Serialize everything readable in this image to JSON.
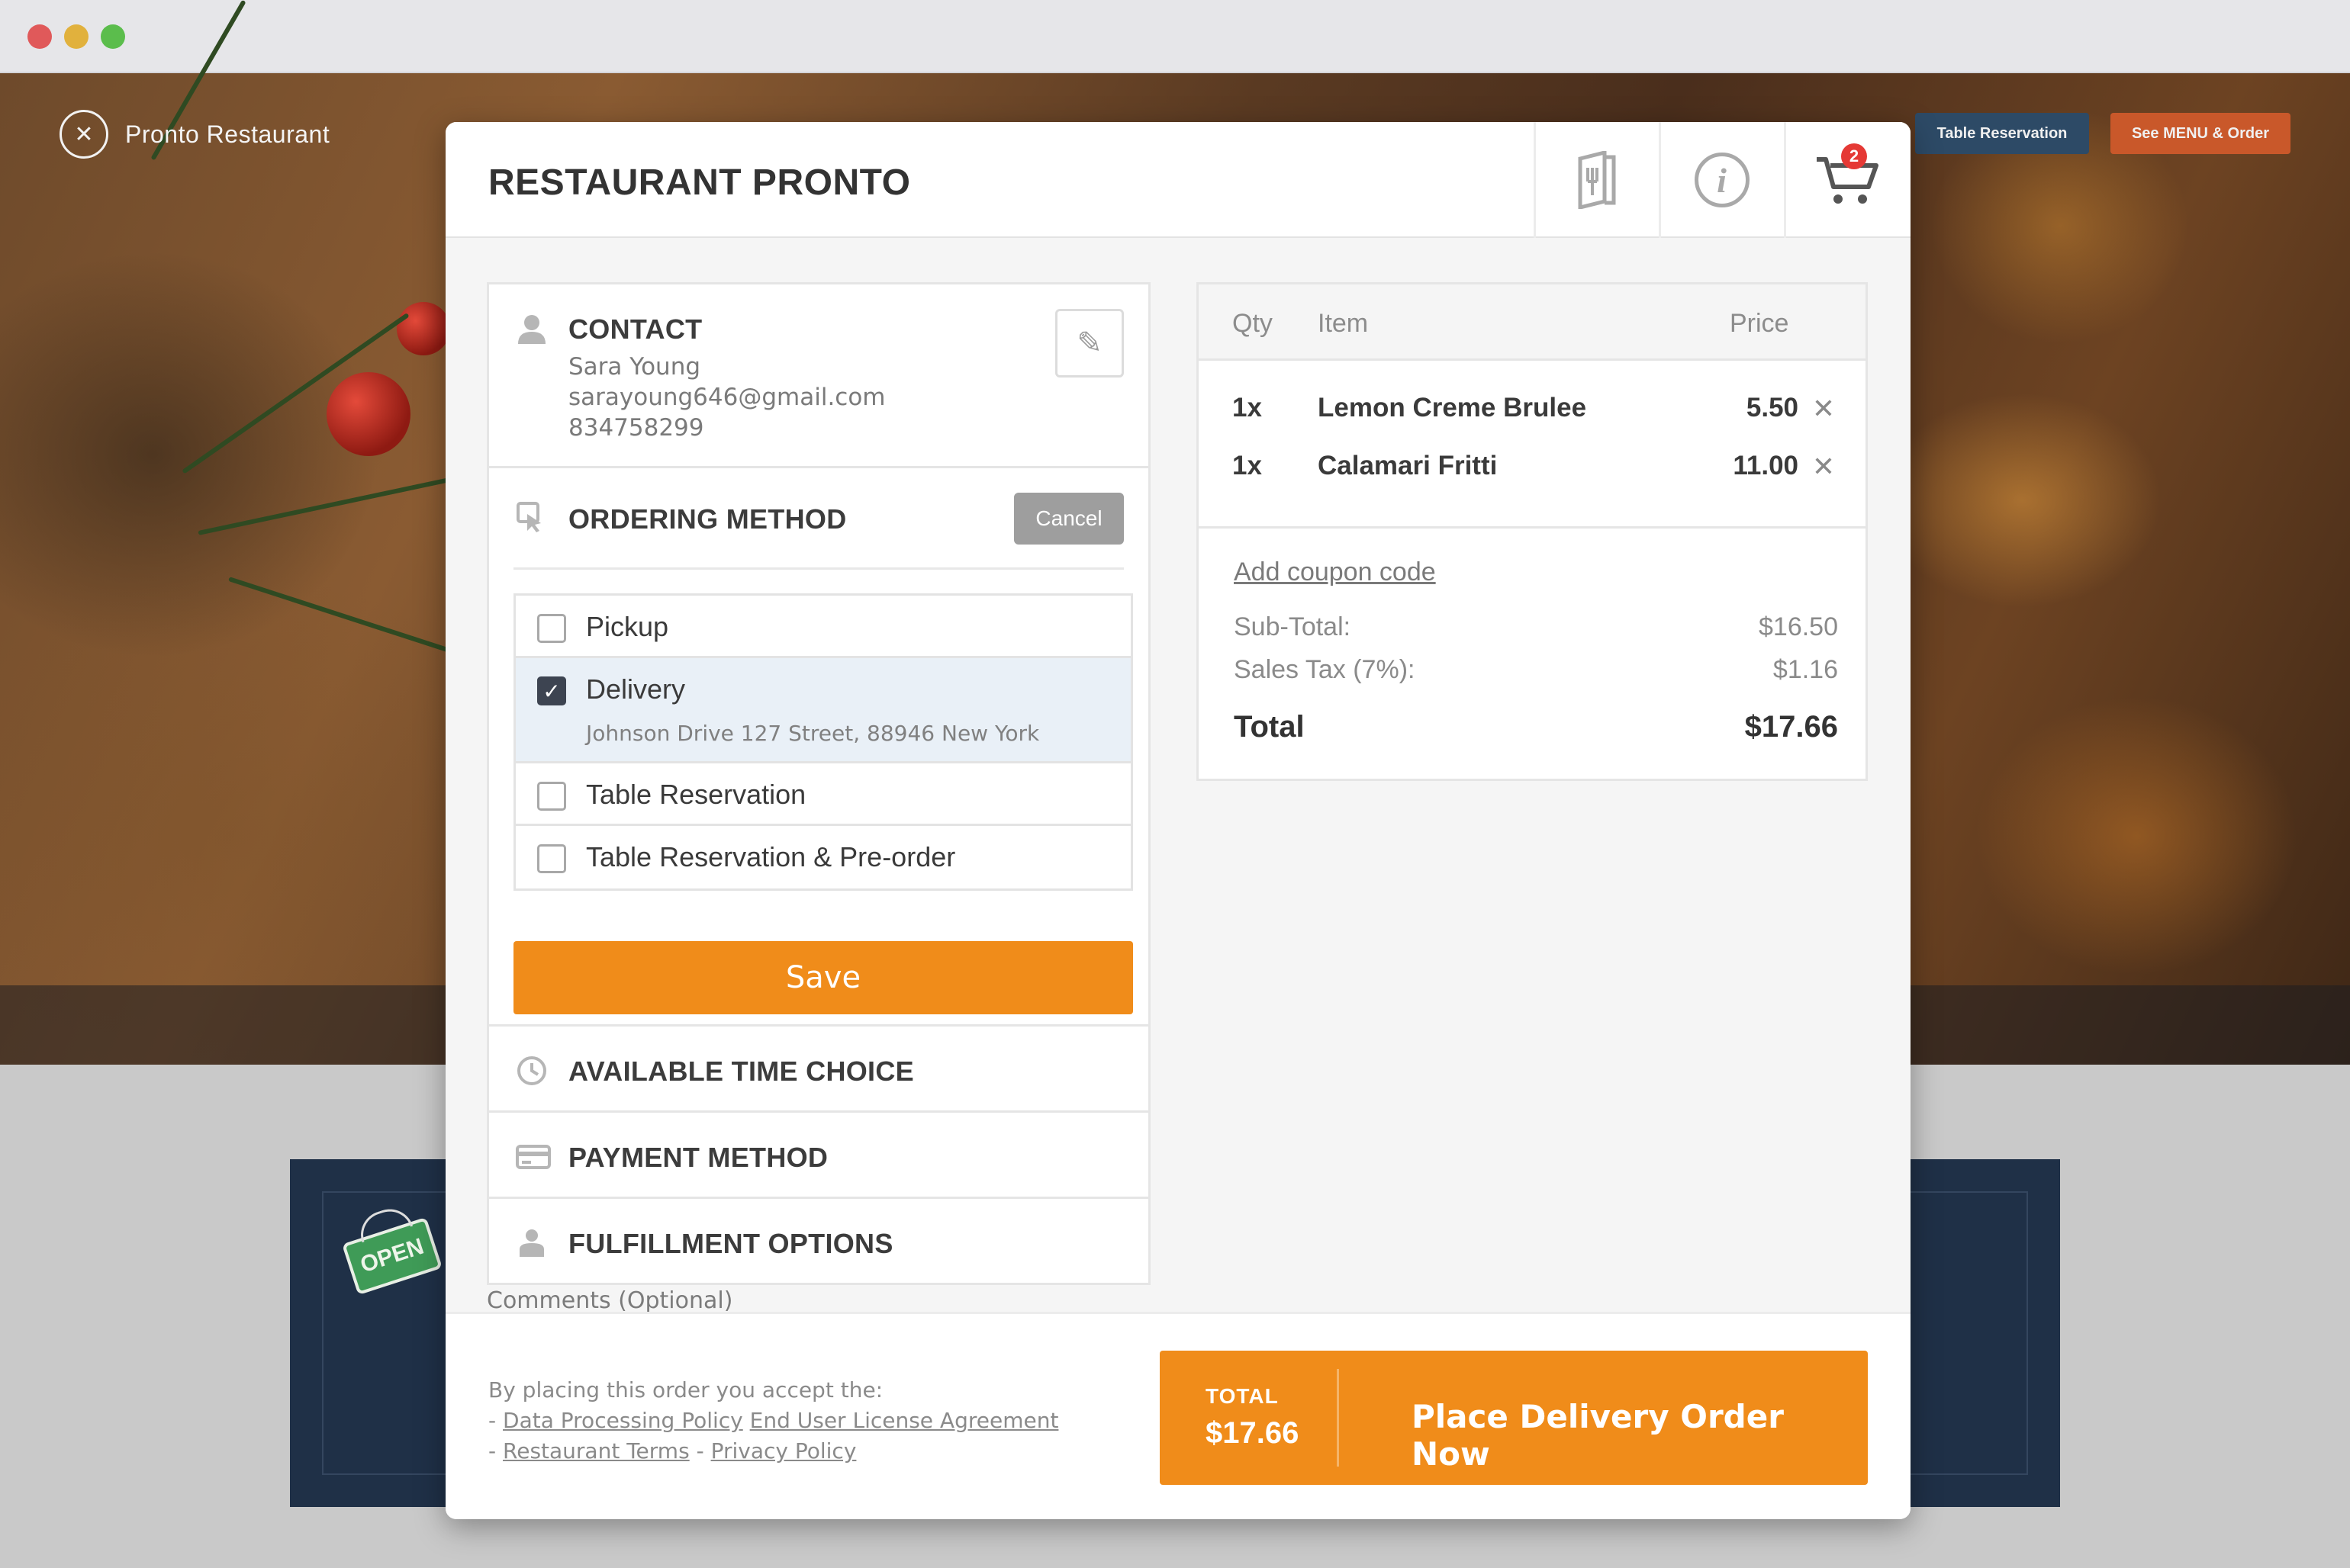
{
  "brand": {
    "name": "Pronto Restaurant"
  },
  "top_nav": {
    "reservation_label": "Table Reservation",
    "menu_label": "See MENU & Order"
  },
  "sign": {
    "text": "OPEN"
  },
  "modal": {
    "title": "RESTAURANT PRONTO",
    "cart_count": "2"
  },
  "contact": {
    "title": "CONTACT",
    "name": "Sara Young",
    "email": "sarayoung646@gmail.com",
    "phone": "834758299"
  },
  "ordering": {
    "title": "ORDERING METHOD",
    "cancel_label": "Cancel",
    "options": [
      {
        "label": "Pickup",
        "checked": false
      },
      {
        "label": "Delivery",
        "checked": true,
        "sub": "Johnson Drive 127 Street, 88946 New York"
      },
      {
        "label": "Table Reservation",
        "checked": false
      },
      {
        "label": "Table Reservation & Pre-order",
        "checked": false
      }
    ],
    "save_label": "Save"
  },
  "sections": {
    "time": "AVAILABLE TIME CHOICE",
    "payment": "PAYMENT METHOD",
    "fulfillment": "FULFILLMENT OPTIONS"
  },
  "comments_label": "Comments (Optional)",
  "summary": {
    "headers": {
      "qty": "Qty",
      "item": "Item",
      "price": "Price"
    },
    "items": [
      {
        "qty": "1x",
        "name": "Lemon Creme Brulee",
        "price": "5.50"
      },
      {
        "qty": "1x",
        "name": "Calamari Fritti",
        "price": "11.00"
      }
    ],
    "coupon_label": "Add coupon code",
    "subtotal_label": "Sub-Total:",
    "subtotal": "$16.50",
    "tax_label": "Sales Tax (7%):",
    "tax": "$1.16",
    "total_label": "Total",
    "total": "$17.66"
  },
  "footer": {
    "legal_intro": "By placing this order you accept the:",
    "link_dpp": "Data Processing Policy",
    "link_eula": "End User License Agreement",
    "link_terms": "Restaurant Terms",
    "link_privacy": "Privacy Policy",
    "total_label": "TOTAL",
    "total_value": "$17.66",
    "place_label": "Place Delivery Order Now"
  },
  "colors": {
    "accent": "#f08c1a",
    "reservation_button": "#2d4a66",
    "menu_button": "#c9582a",
    "badge": "#e53935"
  }
}
